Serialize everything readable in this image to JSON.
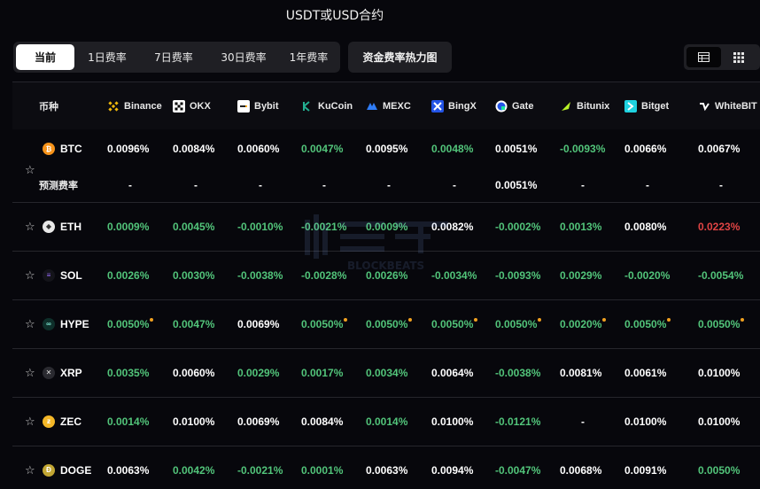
{
  "title": "USDT或USD合约",
  "tabs": [
    {
      "label": "当前",
      "active": true
    },
    {
      "label": "1日费率",
      "active": false
    },
    {
      "label": "7日费率",
      "active": false
    },
    {
      "label": "30日费率",
      "active": false
    },
    {
      "label": "1年费率",
      "active": false
    }
  ],
  "heatmap_label": "资金费率热力图",
  "view_icons": [
    "table-view-icon",
    "grid-view-icon"
  ],
  "columns": {
    "coin": "币种",
    "exchanges": [
      "Binance",
      "OKX",
      "Bybit",
      "KuCoin",
      "MEXC",
      "BingX",
      "Gate",
      "Bitunix",
      "Bitget",
      "WhiteBIT"
    ]
  },
  "predicted_label": "预测费率",
  "watermark_text": "BLOCKBEATS",
  "colors": {
    "green": "#52c47a",
    "red": "#e04444",
    "white": "#ffffff",
    "accent_dot": "#f0a020"
  },
  "rows": [
    {
      "coin": "BTC",
      "icon": "btc-icon",
      "values": [
        "0.0096%",
        "0.0084%",
        "0.0060%",
        "0.0047%",
        "0.0095%",
        "0.0048%",
        "0.0051%",
        "-0.0093%",
        "0.0066%",
        "0.0067%"
      ],
      "tones": [
        "w",
        "w",
        "w",
        "g",
        "w",
        "g",
        "w",
        "g",
        "w",
        "w"
      ],
      "predicted": [
        "-",
        "-",
        "-",
        "-",
        "-",
        "-",
        "0.0051%",
        "-",
        "-",
        "-"
      ]
    },
    {
      "coin": "ETH",
      "icon": "eth-icon",
      "values": [
        "0.0009%",
        "0.0045%",
        "-0.0010%",
        "-0.0021%",
        "0.0009%",
        "0.0082%",
        "-0.0002%",
        "0.0013%",
        "0.0080%",
        "0.0223%"
      ],
      "tones": [
        "g",
        "g",
        "g",
        "g",
        "g",
        "w",
        "g",
        "g",
        "w",
        "r"
      ]
    },
    {
      "coin": "SOL",
      "icon": "sol-icon",
      "values": [
        "0.0026%",
        "0.0030%",
        "-0.0038%",
        "-0.0028%",
        "0.0026%",
        "-0.0034%",
        "-0.0093%",
        "0.0029%",
        "-0.0020%",
        "-0.0054%"
      ],
      "tones": [
        "g",
        "g",
        "g",
        "g",
        "g",
        "g",
        "g",
        "g",
        "g",
        "g"
      ]
    },
    {
      "coin": "HYPE",
      "icon": "hype-icon",
      "values": [
        "0.0050%",
        "0.0047%",
        "0.0069%",
        "0.0050%",
        "0.0050%",
        "0.0050%",
        "0.0050%",
        "0.0020%",
        "0.0050%",
        "0.0050%"
      ],
      "tones": [
        "g",
        "g",
        "w",
        "g",
        "g",
        "g",
        "g",
        "g",
        "g",
        "g"
      ],
      "dots": [
        true,
        false,
        false,
        true,
        true,
        true,
        true,
        true,
        true,
        true
      ]
    },
    {
      "coin": "XRP",
      "icon": "xrp-icon",
      "values": [
        "0.0035%",
        "0.0060%",
        "0.0029%",
        "0.0017%",
        "0.0034%",
        "0.0064%",
        "-0.0038%",
        "0.0081%",
        "0.0061%",
        "0.0100%"
      ],
      "tones": [
        "g",
        "w",
        "g",
        "g",
        "g",
        "w",
        "g",
        "w",
        "w",
        "w"
      ]
    },
    {
      "coin": "ZEC",
      "icon": "zec-icon",
      "values": [
        "0.0014%",
        "0.0100%",
        "0.0069%",
        "0.0084%",
        "0.0014%",
        "0.0100%",
        "-0.0121%",
        "-",
        "0.0100%",
        "0.0100%"
      ],
      "tones": [
        "g",
        "w",
        "w",
        "w",
        "g",
        "w",
        "g",
        "w",
        "w",
        "w"
      ]
    },
    {
      "coin": "DOGE",
      "icon": "doge-icon",
      "values": [
        "0.0063%",
        "0.0042%",
        "-0.0021%",
        "0.0001%",
        "0.0063%",
        "0.0094%",
        "-0.0047%",
        "0.0068%",
        "0.0091%",
        "0.0050%"
      ],
      "tones": [
        "w",
        "g",
        "g",
        "g",
        "w",
        "w",
        "g",
        "w",
        "w",
        "g"
      ]
    }
  ]
}
